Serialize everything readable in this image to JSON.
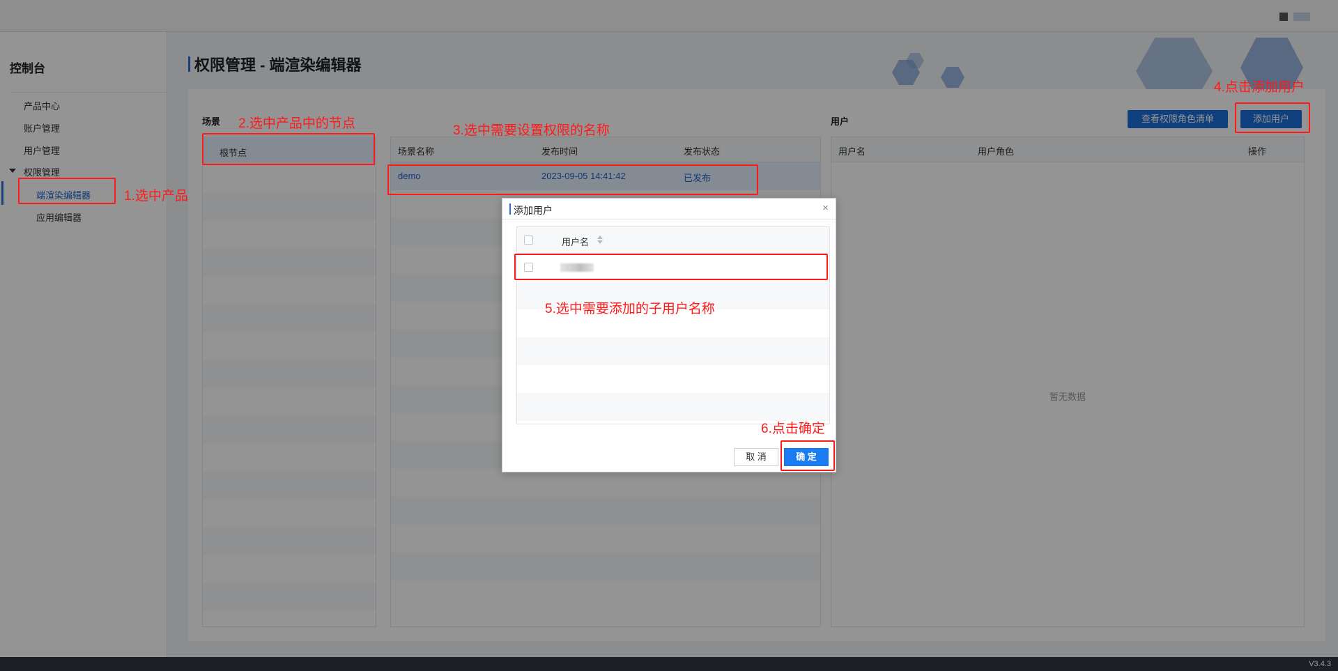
{
  "sidebar": {
    "title": "控制台",
    "items": [
      {
        "label": "产品中心"
      },
      {
        "label": "账户管理"
      },
      {
        "label": "用户管理"
      },
      {
        "label": "权限管理"
      },
      {
        "label": "端渲染编辑器"
      },
      {
        "label": "应用编辑器"
      }
    ]
  },
  "page": {
    "title": "权限管理 - 端渲染编辑器",
    "scene_label": "场景",
    "root_node": "根节点",
    "user_label": "用户",
    "view_roles_button": "查看权限角色清单",
    "add_user_button": "添加用户"
  },
  "scene_table": {
    "columns": [
      "场景名称",
      "发布时间",
      "发布状态"
    ],
    "rows": [
      {
        "name": "demo",
        "time": "2023-09-05 14:41:42",
        "status": "已发布"
      }
    ]
  },
  "user_table": {
    "columns": [
      "用户名",
      "用户角色",
      "操作"
    ],
    "empty_text": "暂无数据"
  },
  "modal": {
    "title": "添加用户",
    "close": "×",
    "column_username": "用户名",
    "cancel": "取 消",
    "confirm": "确 定"
  },
  "annotations": {
    "step1": "1.选中产品",
    "step2": "2.选中产品中的节点",
    "step3": "3.选中需要设置权限的名称",
    "step4": "4.点击添加用户",
    "step5": "5.选中需要添加的子用户名称",
    "step6": "6.点击确定"
  },
  "footer": {
    "version": "V3.4.3"
  },
  "colors": {
    "accent": "#1a6ed8",
    "annotation": "#ff1a1a"
  }
}
